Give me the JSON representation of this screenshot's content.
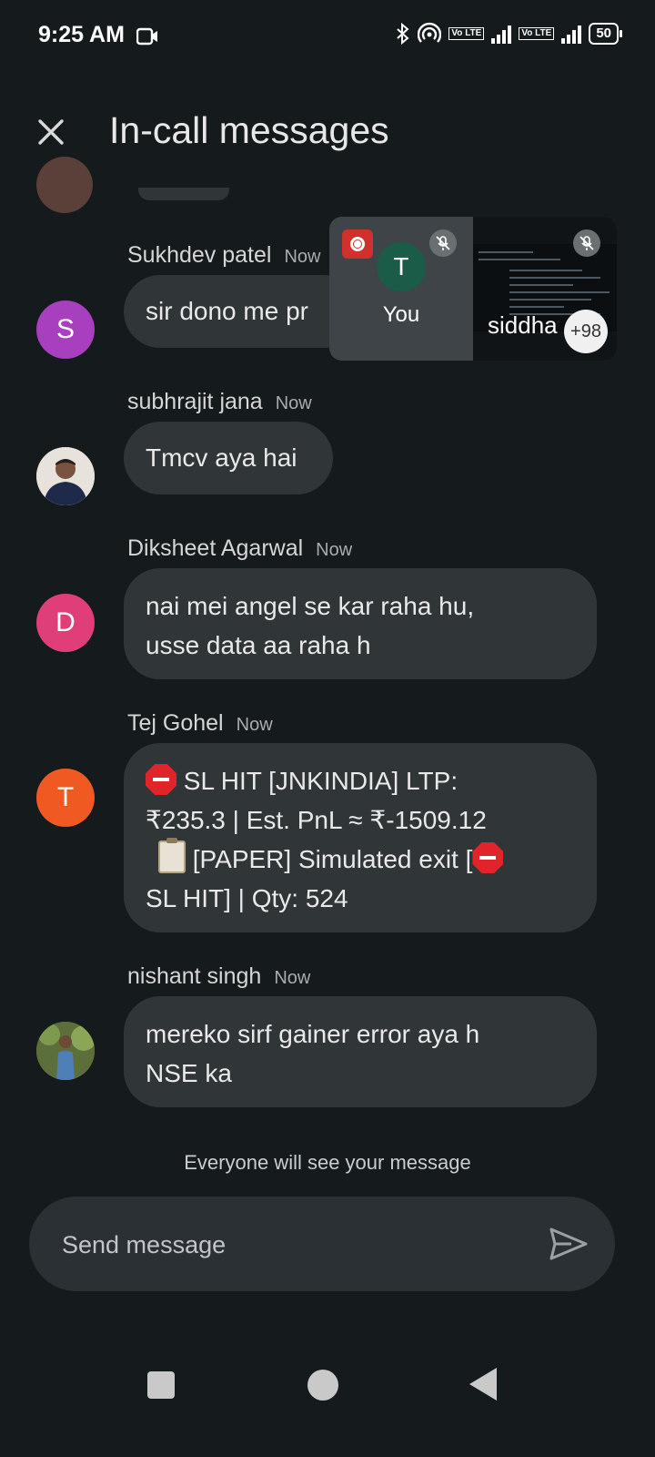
{
  "status_bar": {
    "time": "9:25 AM",
    "battery": "50",
    "network1": "Vo LTE",
    "network2": "Vo LTE"
  },
  "header": {
    "title": "In-call messages",
    "close_icon": "close-icon"
  },
  "messages": [
    {
      "sender": "Sukhdev patel",
      "time": "Now",
      "text": "sir dono me pr",
      "avatar_letter": "S",
      "avatar_color": "#a73fbf"
    },
    {
      "sender": "subhrajit jana",
      "time": "Now",
      "text": "Tmcv aya hai",
      "avatar_letter": "",
      "avatar_color": "#d8d0c7"
    },
    {
      "sender": "Diksheet Agarwal",
      "time": "Now",
      "lines": [
        "nai mei angel se kar raha hu,",
        "usse data aa raha h"
      ],
      "avatar_letter": "D",
      "avatar_color": "#e03e78"
    },
    {
      "sender": "Tej Gohel",
      "time": "Now",
      "parts": {
        "p1": " SL HIT  [JNKINDIA]  LTP:",
        "p2": "₹235.3  |  Est. PnL ≈ ₹-1509.12",
        "p3": " [PAPER] Simulated exit [",
        "p4": "SL HIT] | Qty: 524"
      },
      "avatar_letter": "T",
      "avatar_color": "#f05a22"
    },
    {
      "sender": "nishant singh",
      "time": "Now",
      "lines": [
        "mereko sirf gainer error aya h",
        "NSE ka"
      ],
      "avatar_letter": "",
      "avatar_color": "#6f7a4a"
    }
  ],
  "pip": {
    "self_initial": "T",
    "self_label": "You",
    "other_name": "siddha",
    "participants_more": "+98"
  },
  "footer": {
    "notice": "Everyone will see your message",
    "input_placeholder": "Send message",
    "send_icon": "send-icon"
  }
}
